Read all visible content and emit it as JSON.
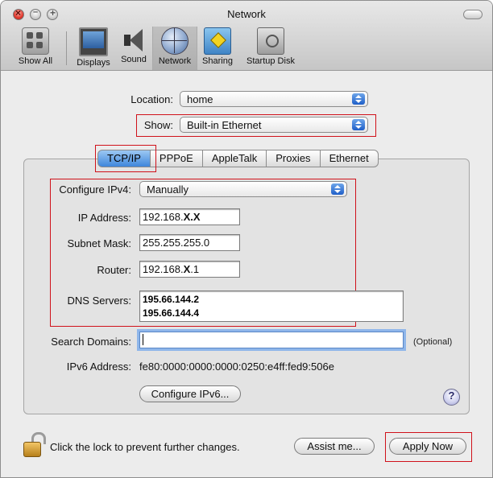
{
  "window": {
    "title": "Network"
  },
  "toolbar": {
    "items": [
      {
        "label": "Show All",
        "icon": "show-all-icon"
      },
      {
        "label": "Displays",
        "icon": "displays-icon"
      },
      {
        "label": "Sound",
        "icon": "sound-icon"
      },
      {
        "label": "Network",
        "icon": "network-icon",
        "active": true
      },
      {
        "label": "Sharing",
        "icon": "sharing-icon"
      },
      {
        "label": "Startup Disk",
        "icon": "startup-disk-icon"
      }
    ]
  },
  "location": {
    "label": "Location:",
    "value": "home"
  },
  "show": {
    "label": "Show:",
    "value": "Built-in Ethernet"
  },
  "tabs": [
    {
      "label": "TCP/IP",
      "selected": true
    },
    {
      "label": "PPPoE"
    },
    {
      "label": "AppleTalk"
    },
    {
      "label": "Proxies"
    },
    {
      "label": "Ethernet"
    }
  ],
  "tcpip": {
    "configure": {
      "label": "Configure IPv4:",
      "value": "Manually"
    },
    "ip": {
      "label": "IP Address:",
      "prefix": "192.168.",
      "masked": "X.X",
      "suffix": ""
    },
    "subnet": {
      "label": "Subnet Mask:",
      "value": "255.255.255.0"
    },
    "router": {
      "label": "Router:",
      "prefix": "192.168.",
      "masked": "X",
      "suffix": ".1"
    },
    "dns": {
      "label": "DNS Servers:",
      "servers": [
        "195.66.144.2",
        "195.66.144.4"
      ]
    },
    "search": {
      "label": "Search Domains:",
      "value": "",
      "hint": "(Optional)"
    },
    "ipv6": {
      "label": "IPv6 Address:",
      "value": "fe80:0000:0000:0000:0250:e4ff:fed9:506e"
    },
    "configure_ipv6_label": "Configure IPv6...",
    "help_label": "?"
  },
  "footer": {
    "lock_text": "Click the lock to prevent further changes.",
    "assist_label": "Assist me...",
    "apply_label": "Apply Now"
  },
  "colors": {
    "highlight_box": "#d0111a",
    "accent": "#3f86db"
  }
}
